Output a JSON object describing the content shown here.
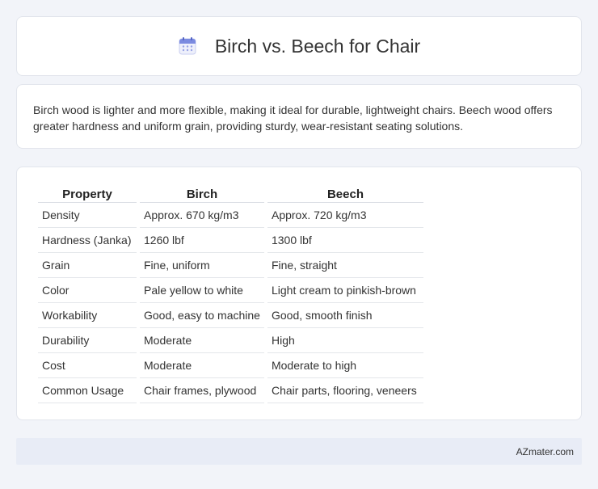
{
  "header": {
    "icon": "calendar-icon",
    "title": "Birch vs. Beech for Chair"
  },
  "description": "Birch wood is lighter and more flexible, making it ideal for durable, lightweight chairs. Beech wood offers greater hardness and uniform grain, providing sturdy, wear-resistant seating solutions.",
  "table": {
    "headers": [
      "Property",
      "Birch",
      "Beech"
    ],
    "rows": [
      [
        "Density",
        "Approx. 670 kg/m3",
        "Approx. 720 kg/m3"
      ],
      [
        "Hardness (Janka)",
        "1260 lbf",
        "1300 lbf"
      ],
      [
        "Grain",
        "Fine, uniform",
        "Fine, straight"
      ],
      [
        "Color",
        "Pale yellow to white",
        "Light cream to pinkish-brown"
      ],
      [
        "Workability",
        "Good, easy to machine",
        "Good, smooth finish"
      ],
      [
        "Durability",
        "Moderate",
        "High"
      ],
      [
        "Cost",
        "Moderate",
        "Moderate to high"
      ],
      [
        "Common Usage",
        "Chair frames, plywood",
        "Chair parts, flooring, veneers"
      ]
    ]
  },
  "footer": {
    "brand": "AZmater.com"
  },
  "colors": {
    "page_background": "#f2f4f9",
    "card_background": "#ffffff",
    "footer_background": "#e8ecf6",
    "icon_accent": "#6c7bd8"
  }
}
